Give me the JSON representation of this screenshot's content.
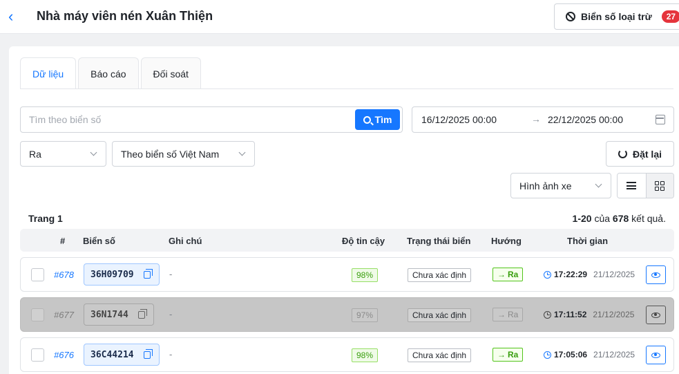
{
  "header": {
    "title": "Nhà máy viên nén Xuân Thiện",
    "excluded_label": "Biển số loại trừ",
    "excluded_count": "27"
  },
  "tabs": [
    {
      "label": "Dữ liệu",
      "active": true
    },
    {
      "label": "Báo cáo",
      "active": false
    },
    {
      "label": "Đối soát",
      "active": false
    }
  ],
  "search": {
    "placeholder": "Tìm theo biển số",
    "value": "",
    "button_label": "Tìm"
  },
  "date_range": {
    "from": "16/12/2025 00:00",
    "separator": "→",
    "to": "22/12/2025 00:00"
  },
  "filters": {
    "direction": "Ra",
    "plate_type": "Theo biển số Việt Nam",
    "reset_label": "Đặt lại",
    "view_mode": "Hình ảnh xe"
  },
  "pagination": {
    "page_label": "Trang 1",
    "range": "1-20",
    "of": "của",
    "total": "678",
    "suffix": "kết quả."
  },
  "table": {
    "headers": [
      "#",
      "Biển số",
      "Ghi chú",
      "Độ tin cậy",
      "Trạng thái biển",
      "Hướng",
      "Thời gian"
    ],
    "rows": [
      {
        "id": "#678",
        "plate": "36H09709",
        "note": "-",
        "confidence": "98%",
        "status": "Chưa xác định",
        "direction": "Ra",
        "time": "17:22:29",
        "date": "21/12/2025",
        "dimmed": false
      },
      {
        "id": "#677",
        "plate": "36N1744",
        "note": "-",
        "confidence": "97%",
        "status": "Chưa xác định",
        "direction": "Ra",
        "time": "17:11:52",
        "date": "21/12/2025",
        "dimmed": true
      },
      {
        "id": "#676",
        "plate": "36C44214",
        "note": "-",
        "confidence": "98%",
        "status": "Chưa xác định",
        "direction": "Ra",
        "time": "17:05:06",
        "date": "21/12/2025",
        "dimmed": false
      }
    ]
  },
  "colors": {
    "primary": "#1677ff",
    "badge": "#e5343c",
    "success": "#389e0d",
    "dimmed_row": "#c6c6c6"
  }
}
